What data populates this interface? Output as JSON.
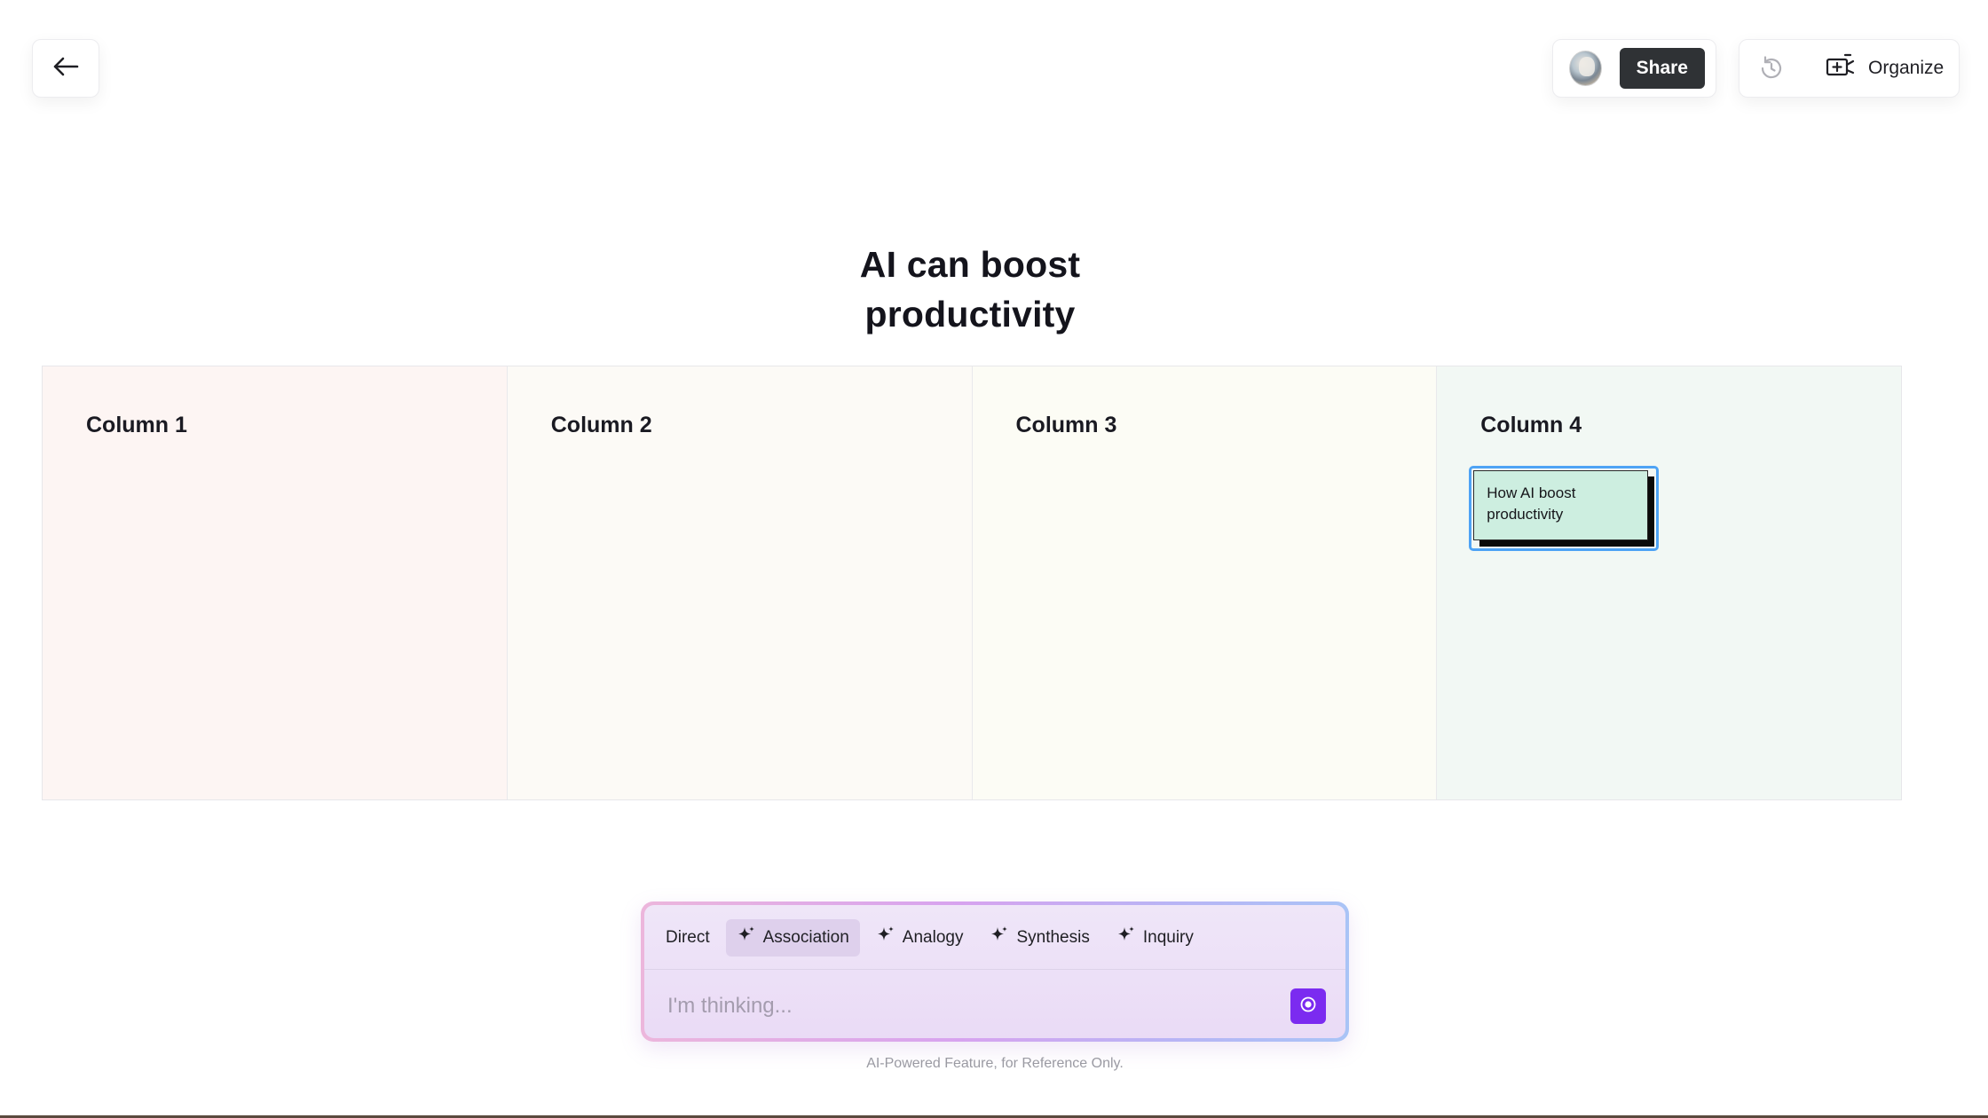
{
  "toolbar": {
    "share_label": "Share",
    "organize_label": "Organize",
    "icons": {
      "back": "arrow-left-icon",
      "history": "history-icon",
      "organize": "add-to-board-icon"
    }
  },
  "board": {
    "title_line1": "AI can boost",
    "title_line2": "productivity",
    "columns": [
      {
        "label": "Column 1",
        "color": "#fdf5f3"
      },
      {
        "label": "Column 2",
        "color": "#fcfaf6"
      },
      {
        "label": "Column 3",
        "color": "#fcfcf5"
      },
      {
        "label": "Column 4",
        "color": "#f2f8f4"
      }
    ],
    "sticky": {
      "text": "How AI boost productivity",
      "color": "#cdeee0",
      "selected": true
    }
  },
  "prompt": {
    "modes": [
      {
        "label": "Direct",
        "icon": ""
      },
      {
        "label": "Association",
        "icon": "sparkle-icon"
      },
      {
        "label": "Analogy",
        "icon": "sparkle-icon"
      },
      {
        "label": "Synthesis",
        "icon": "sparkle-icon"
      },
      {
        "label": "Inquiry",
        "icon": "sparkle-icon"
      }
    ],
    "active_mode": "Association",
    "input_value": "",
    "placeholder": "I'm thinking...",
    "send_color": "#7b2bf0",
    "disclaimer": "AI-Powered Feature, for Reference Only."
  }
}
